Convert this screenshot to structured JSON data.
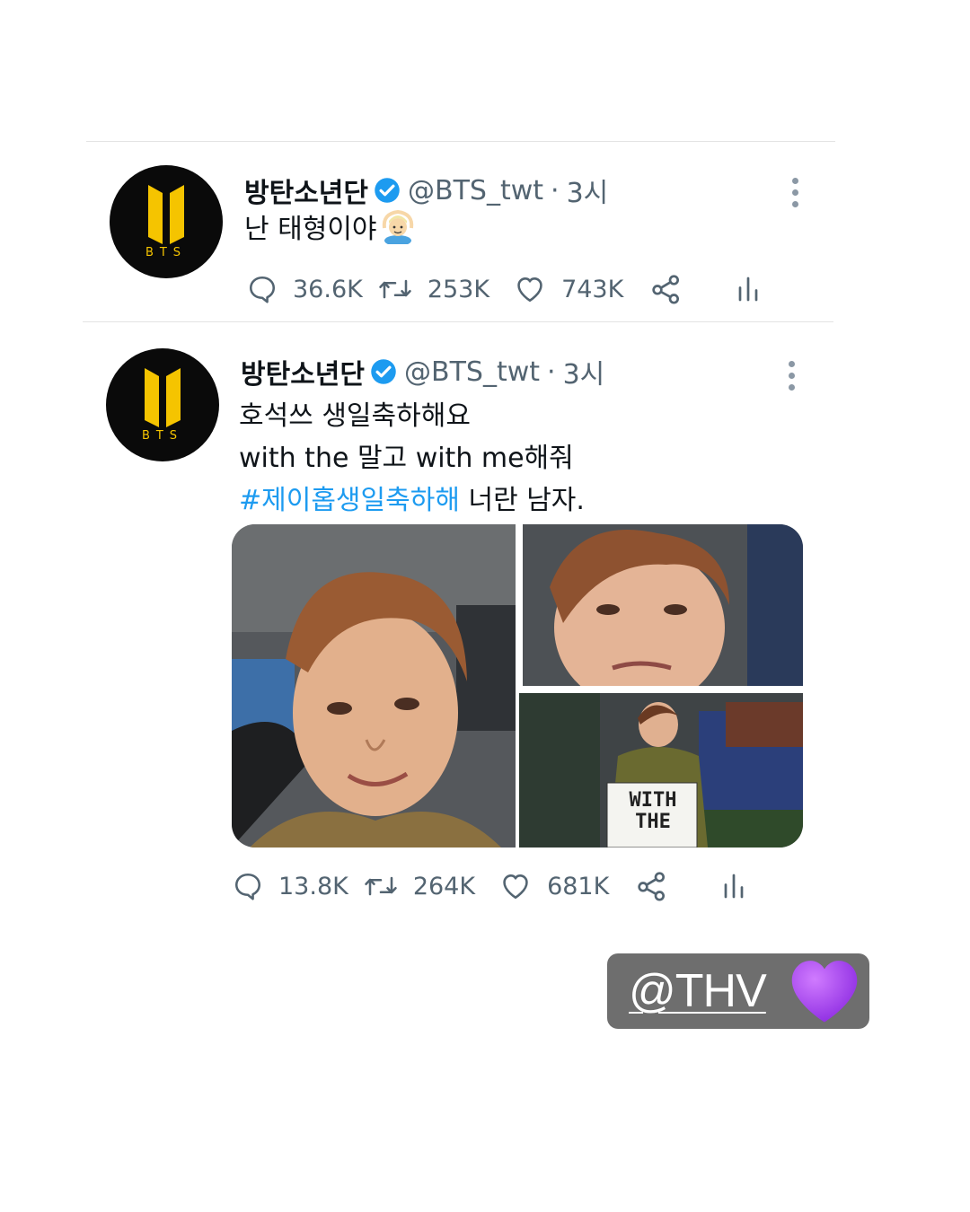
{
  "tweets": [
    {
      "author_name": "방탄소년단",
      "handle": "@BTS_twt",
      "separator": "·",
      "time": "3시",
      "avatar_text": "BTS",
      "lines": [
        "난 태형이야"
      ],
      "reply_count": "36.6K",
      "retweet_count": "253K",
      "like_count": "743K"
    },
    {
      "author_name": "방탄소년단",
      "handle": "@BTS_twt",
      "separator": "·",
      "time": "3시",
      "avatar_text": "BTS",
      "line1": "호석쓰 생일축하해요",
      "line2": "with the 말고 with me해줘",
      "hashtag": "#제이홉생일축하해",
      "line3_rest": " 너란 남자.",
      "photo_sign_text": "WITH THE",
      "reply_count": "13.8K",
      "retweet_count": "264K",
      "like_count": "681K"
    }
  ],
  "sticker": {
    "mention": "@THV",
    "emoji": "purple-heart",
    "background": "#6e6e6e"
  },
  "colors": {
    "verified": "#1d9bf0",
    "hashtag": "#1d9bf0",
    "avatar_bg": "#0a0a0a",
    "avatar_logo": "#f5c400",
    "heart": "#a43ff0"
  }
}
